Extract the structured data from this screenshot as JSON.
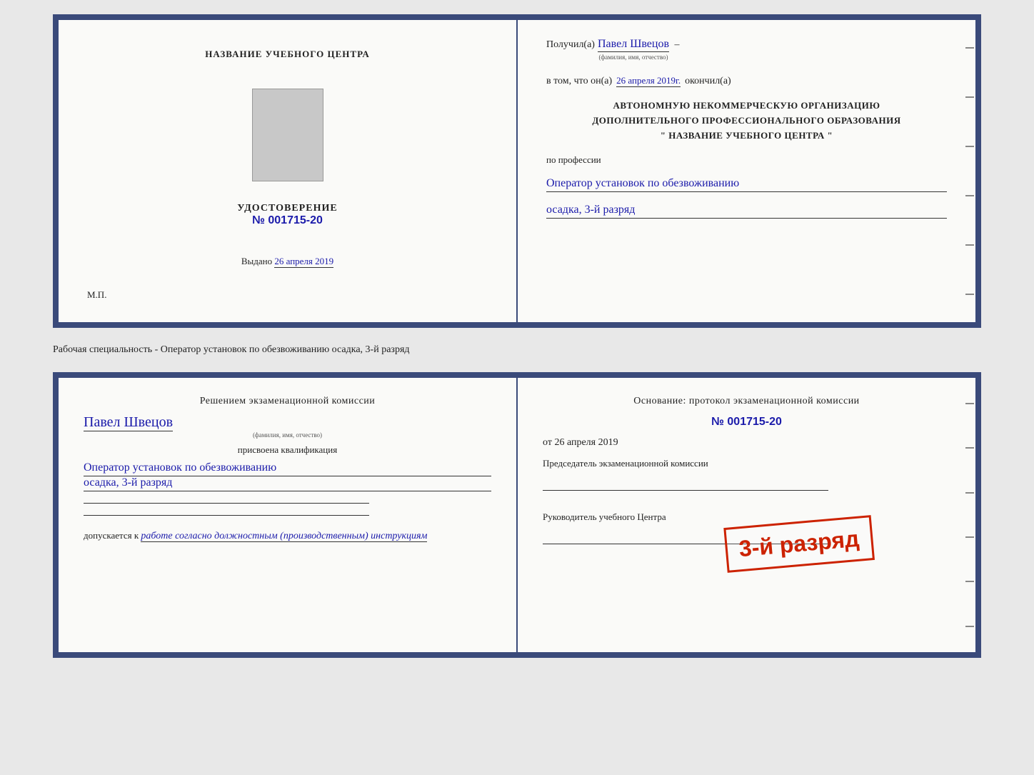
{
  "top_doc": {
    "left": {
      "school_name": "НАЗВАНИЕ УЧЕБНОГО ЦЕНТРА",
      "photo_alt": "Фото",
      "cert_title": "УДОСТОВЕРЕНИЕ",
      "cert_number_prefix": "№",
      "cert_number": "001715-20",
      "vydano_label": "Выдано",
      "vydano_date": "26 апреля 2019",
      "mp_label": "М.П."
    },
    "right": {
      "poluchil_label": "Получил(а)",
      "poluchil_name": "Павел Швецов",
      "fio_hint": "(фамилия, имя, отчество)",
      "v_tom_label": "в том, что он(а)",
      "date_value": "26 апреля 2019г.",
      "okonchil_label": "окончил(а)",
      "org_line1": "АВТОНОМНУЮ НЕКОММЕРЧЕСКУЮ ОРГАНИЗАЦИЮ",
      "org_line2": "ДОПОЛНИТЕЛЬНОГО ПРОФЕССИОНАЛЬНОГО ОБРАЗОВАНИЯ",
      "org_line3": "\"    НАЗВАНИЕ УЧЕБНОГО ЦЕНТРА    \"",
      "po_professii_label": "по профессии",
      "profession": "Оператор установок по обезвоживанию",
      "speciality": "осадка, 3-й разряд"
    }
  },
  "separator": {
    "text": "Рабочая специальность - Оператор установок по обезвоживанию осадка, 3-й разряд"
  },
  "bottom_doc": {
    "left": {
      "resheniem_label": "Решением  экзаменационной  комиссии",
      "name": "Павел Швецов",
      "fio_hint": "(фамилия, имя, отчество)",
      "prisvoena_label": "присвоена квалификация",
      "profession": "Оператор установок по обезвоживанию",
      "speciality": "осадка, 3-й разряд",
      "dopusk_label": "допускается к",
      "dopusk_value": "работе согласно должностным (производственным) инструкциям"
    },
    "right": {
      "osnovanie_label": "Основание: протокол экзаменационной  комиссии",
      "number_prefix": "№",
      "number": "001715-20",
      "ot_label": "от",
      "date": "26 апреля 2019",
      "predsedatel_label": "Председатель экзаменационной комиссии",
      "rukovoditel_label": "Руководитель учебного Центра"
    },
    "stamp": {
      "text": "3-й разряд"
    }
  }
}
